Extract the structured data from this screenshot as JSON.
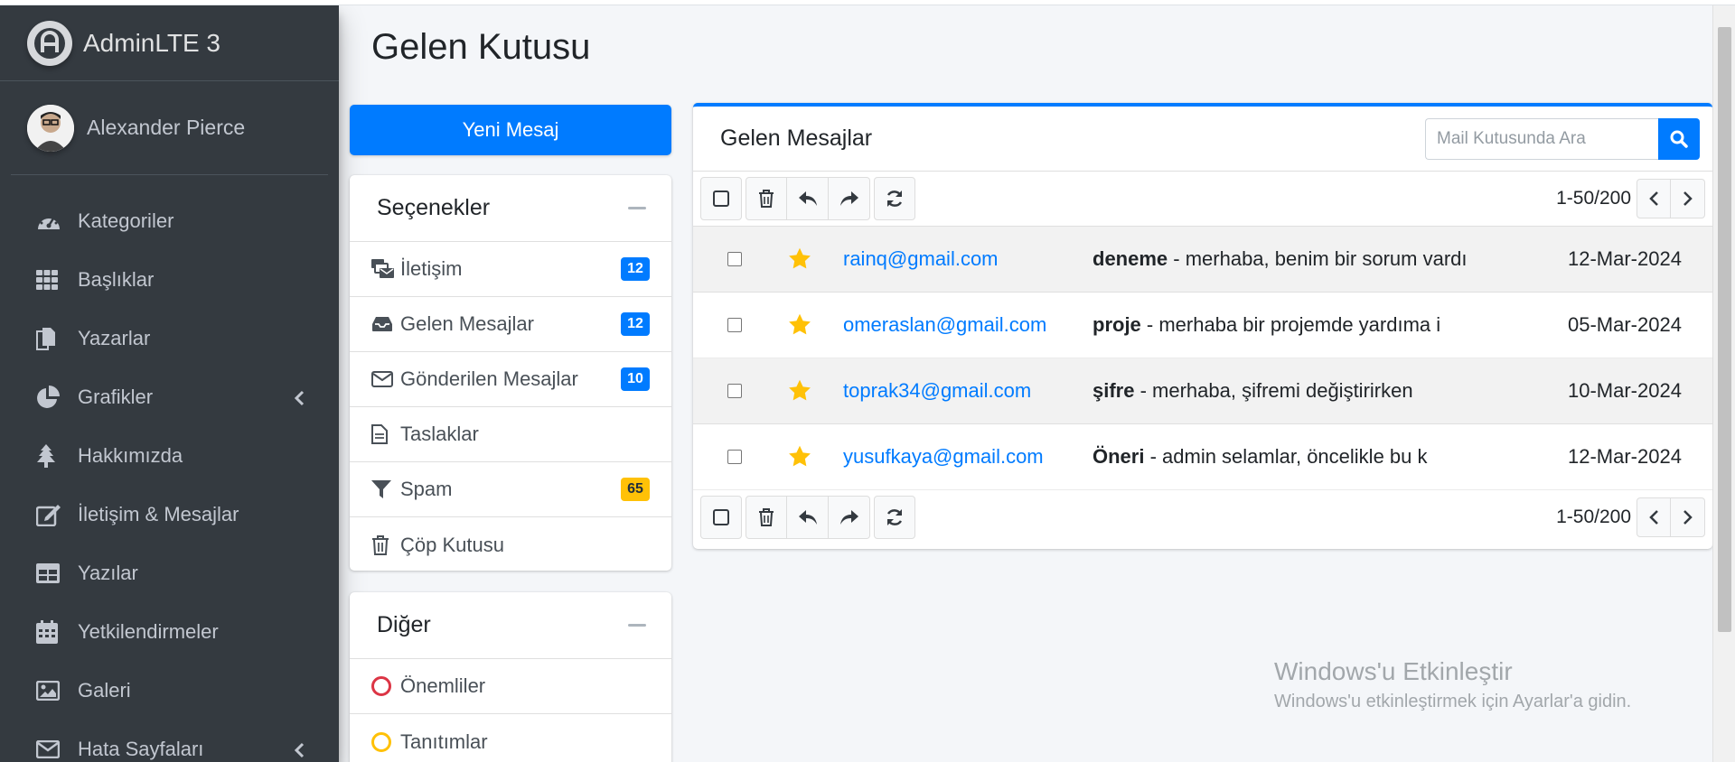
{
  "brand": {
    "name": "AdminLTE 3"
  },
  "user": {
    "name": "Alexander Pierce"
  },
  "sidebar": {
    "items": [
      {
        "label": "Kategoriler",
        "icon": "tachometer-icon",
        "has_submenu": false
      },
      {
        "label": "Başlıklar",
        "icon": "grid-icon",
        "has_submenu": false
      },
      {
        "label": "Yazarlar",
        "icon": "copy-icon",
        "has_submenu": false
      },
      {
        "label": "Grafikler",
        "icon": "chart-pie-icon",
        "has_submenu": true
      },
      {
        "label": "Hakkımızda",
        "icon": "tree-icon",
        "has_submenu": false
      },
      {
        "label": "İletişim & Mesajlar",
        "icon": "edit-icon",
        "has_submenu": false
      },
      {
        "label": "Yazılar",
        "icon": "table-icon",
        "has_submenu": false
      },
      {
        "label": "Yetkilendirmeler",
        "icon": "calendar-icon",
        "has_submenu": false
      },
      {
        "label": "Galeri",
        "icon": "image-icon",
        "has_submenu": false
      },
      {
        "label": "Hata Sayfaları",
        "icon": "envelope-icon",
        "has_submenu": true
      }
    ]
  },
  "page": {
    "title": "Gelen Kutusu"
  },
  "compose": {
    "label": "Yeni Mesaj"
  },
  "folders": {
    "title": "Seçenekler",
    "items": [
      {
        "label": "İletişim",
        "icon": "mail-bulk-icon",
        "count": "12",
        "badge_color": "#007bff"
      },
      {
        "label": "Gelen Mesajlar",
        "icon": "inbox-icon",
        "count": "12",
        "badge_color": "#007bff"
      },
      {
        "label": "Gönderilen Mesajlar",
        "icon": "envelope-icon",
        "count": "10",
        "badge_color": "#007bff"
      },
      {
        "label": "Taslaklar",
        "icon": "file-icon",
        "count": "",
        "badge_color": ""
      },
      {
        "label": "Spam",
        "icon": "filter-icon",
        "count": "65",
        "badge_color": "#ffc107"
      },
      {
        "label": "Çöp Kutusu",
        "icon": "trash-icon",
        "count": "",
        "badge_color": ""
      }
    ]
  },
  "labels": {
    "title": "Diğer",
    "items": [
      {
        "label": "Önemliler",
        "icon": "circle-icon",
        "color": "#dc3545"
      },
      {
        "label": "Tanıtımlar",
        "icon": "circle-icon",
        "color": "#ffc107"
      }
    ]
  },
  "mailbox": {
    "title": "Gelen Mesajlar",
    "search_placeholder": "Mail Kutusunda Ara",
    "page_info": "1-50/200",
    "messages": [
      {
        "from": "rainq@gmail.com",
        "subject": "deneme",
        "preview": " - merhaba, benim bir sorum vardı",
        "date": "12-Mar-2024",
        "starred": true
      },
      {
        "from": "omeraslan@gmail.com",
        "subject": "proje",
        "preview": " - merhaba bir projemde yardıma i",
        "date": "05-Mar-2024",
        "starred": true
      },
      {
        "from": "toprak34@gmail.com",
        "subject": "şifre",
        "preview": " - merhaba, şifremi değiştirirken",
        "date": "10-Mar-2024",
        "starred": true
      },
      {
        "from": "yusufkaya@gmail.com",
        "subject": "Öneri",
        "preview": " - admin selamlar, öncelikle bu k",
        "date": "12-Mar-2024",
        "starred": true
      }
    ]
  },
  "watermark": {
    "line1": "Windows'u Etkinleştir",
    "line2": "Windows'u etkinleştirmek için Ayarlar'a gidin."
  },
  "colors": {
    "sidebar_bg": "#343a40",
    "primary": "#007bff",
    "warning": "#ffc107",
    "danger": "#dc3545",
    "star": "#ffc107"
  }
}
